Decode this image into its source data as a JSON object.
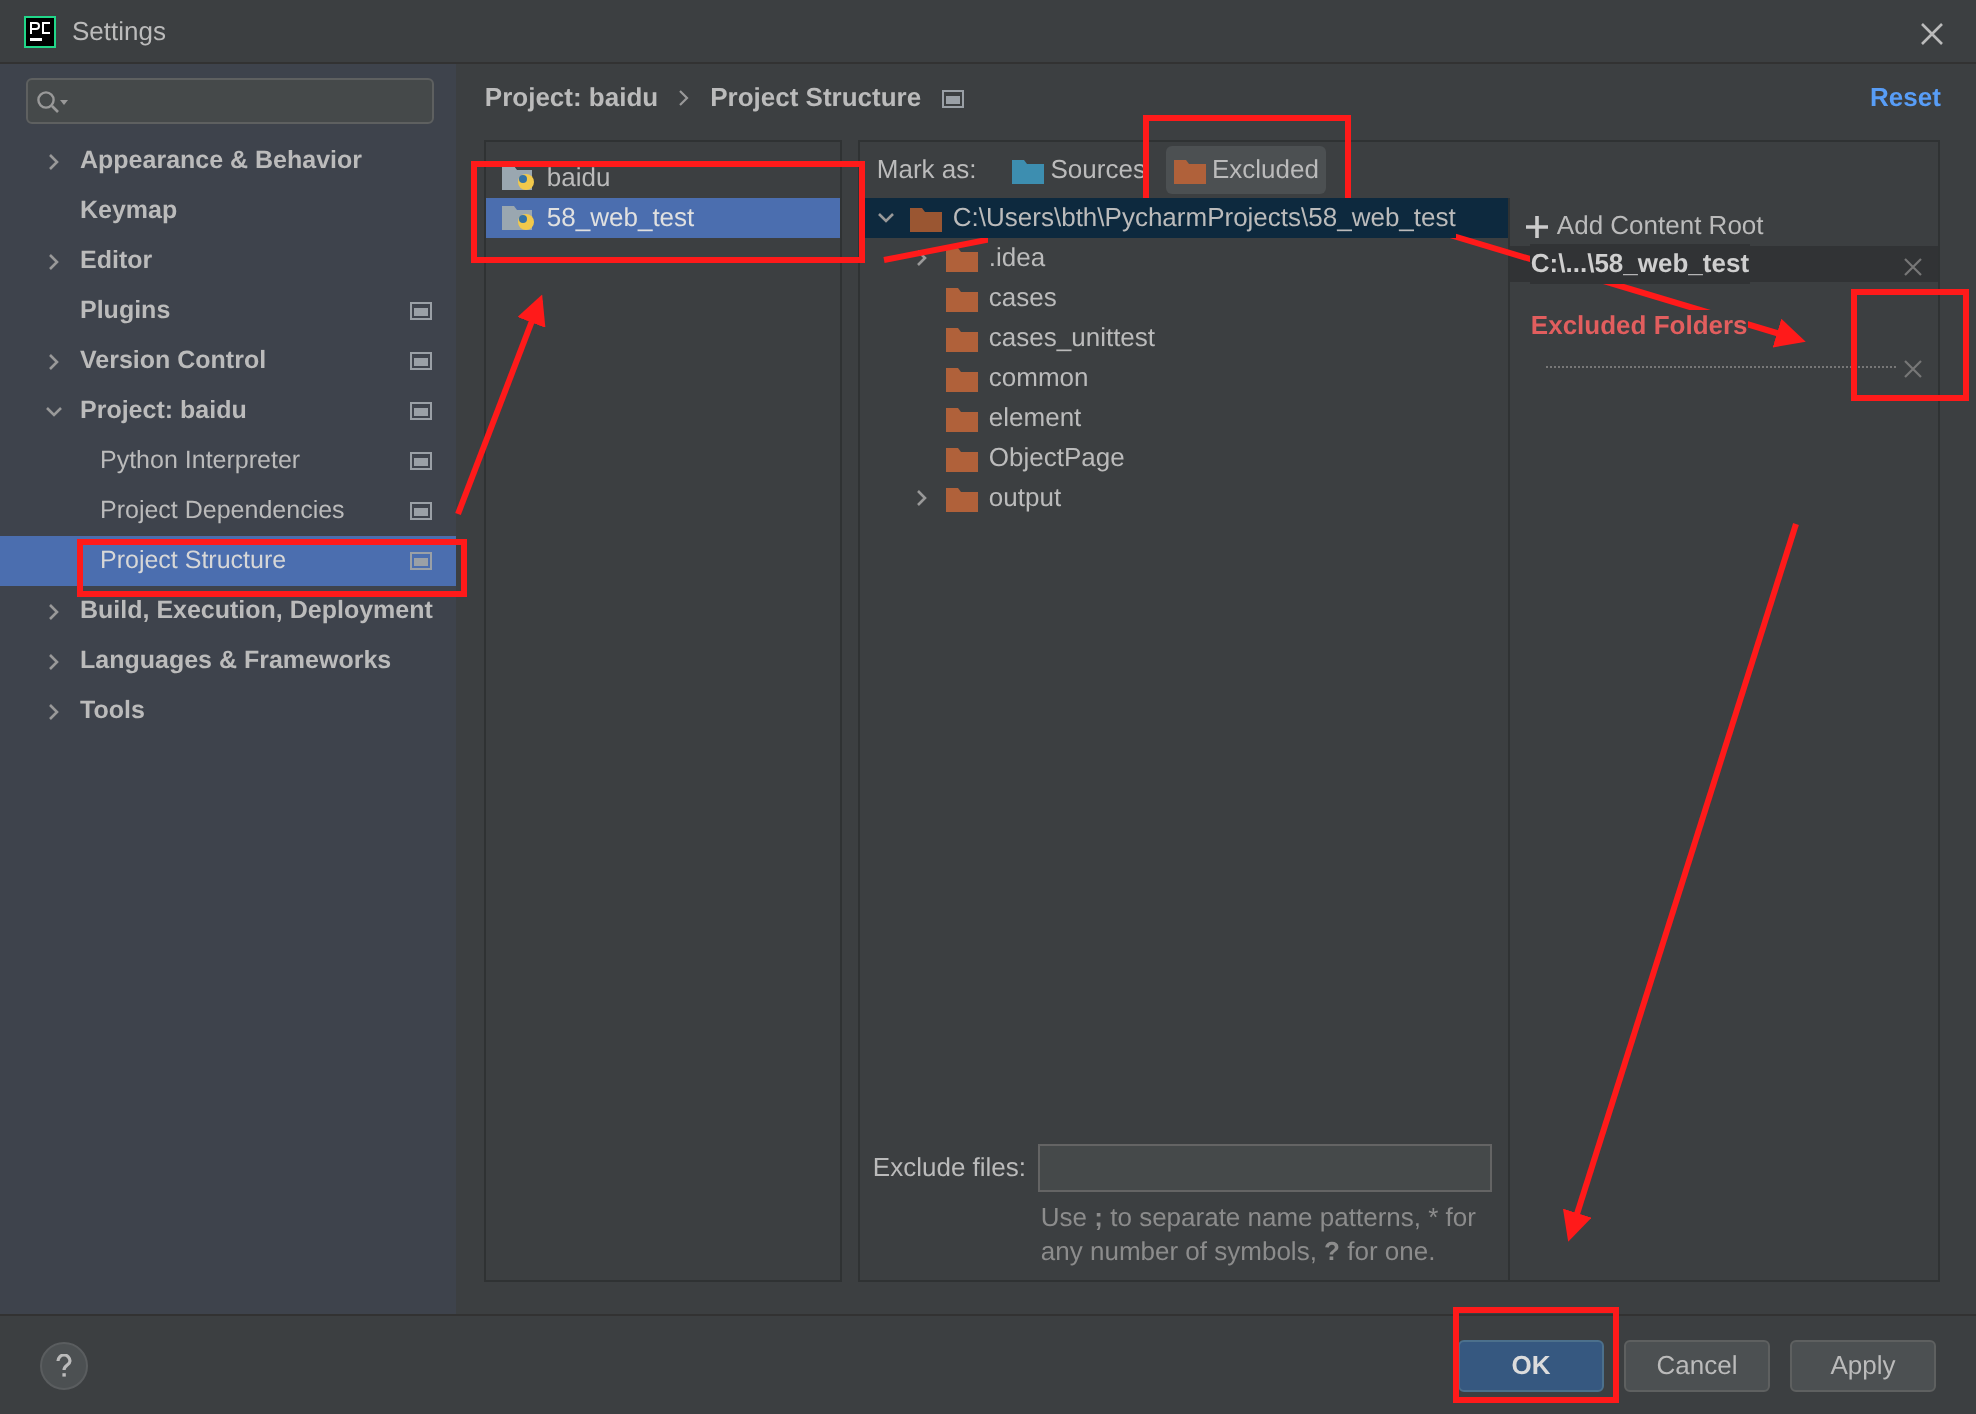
{
  "window": {
    "title": "Settings"
  },
  "sidebar": {
    "items": [
      {
        "label": "Appearance & Behavior",
        "expandable": true,
        "expanded": false,
        "selected": false,
        "project_scoped": false
      },
      {
        "label": "Keymap",
        "expandable": false,
        "selected": false,
        "project_scoped": false
      },
      {
        "label": "Editor",
        "expandable": true,
        "expanded": false,
        "selected": false,
        "project_scoped": false
      },
      {
        "label": "Plugins",
        "expandable": false,
        "selected": false,
        "project_scoped": true
      },
      {
        "label": "Version Control",
        "expandable": true,
        "expanded": false,
        "selected": false,
        "project_scoped": true
      },
      {
        "label": "Project: baidu",
        "expandable": true,
        "expanded": true,
        "selected": false,
        "project_scoped": true,
        "children": [
          {
            "label": "Python Interpreter",
            "selected": false,
            "project_scoped": true
          },
          {
            "label": "Project Dependencies",
            "selected": false,
            "project_scoped": true
          },
          {
            "label": "Project Structure",
            "selected": true,
            "project_scoped": true
          }
        ]
      },
      {
        "label": "Build, Execution, Deployment",
        "expandable": true,
        "expanded": false,
        "selected": false,
        "project_scoped": false
      },
      {
        "label": "Languages & Frameworks",
        "expandable": true,
        "expanded": false,
        "selected": false,
        "project_scoped": false
      },
      {
        "label": "Tools",
        "expandable": true,
        "expanded": false,
        "selected": false,
        "project_scoped": false
      }
    ]
  },
  "breadcrumb": [
    "Project: baidu",
    "Project Structure"
  ],
  "reset_link": "Reset",
  "modules": [
    {
      "name": "baidu",
      "selected": false
    },
    {
      "name": "58_web_test",
      "selected": true
    }
  ],
  "mark_as": {
    "label": "Mark as:",
    "buttons": [
      {
        "label": "Sources",
        "color": "#3d8eb0",
        "selected": false
      },
      {
        "label": "Excluded",
        "color": "#b0613a",
        "selected": true
      }
    ]
  },
  "tree": {
    "label": "C:\\Users\\bth\\PycharmProjects\\58_web_test",
    "expanded": true,
    "selected": true,
    "children": [
      {
        "label": ".idea",
        "expandable": true
      },
      {
        "label": "cases",
        "expandable": false
      },
      {
        "label": "cases_unittest",
        "expandable": false
      },
      {
        "label": "common",
        "expandable": false
      },
      {
        "label": "element",
        "expandable": false
      },
      {
        "label": "ObjectPage",
        "expandable": false
      },
      {
        "label": "output",
        "expandable": true
      }
    ]
  },
  "content_root": {
    "add_label": "Add Content Root",
    "root": "C:\\...\\58_web_test",
    "excluded_heading": "Excluded Folders"
  },
  "exclude_files": {
    "label": "Exclude files:",
    "hint": "Use **;** to separate name patterns, * for any number of symbols, **?** for one."
  },
  "buttons": [
    {
      "label": "OK",
      "kind": "primary"
    },
    {
      "label": "Cancel",
      "kind": "default"
    },
    {
      "label": "Apply",
      "kind": "default"
    }
  ]
}
